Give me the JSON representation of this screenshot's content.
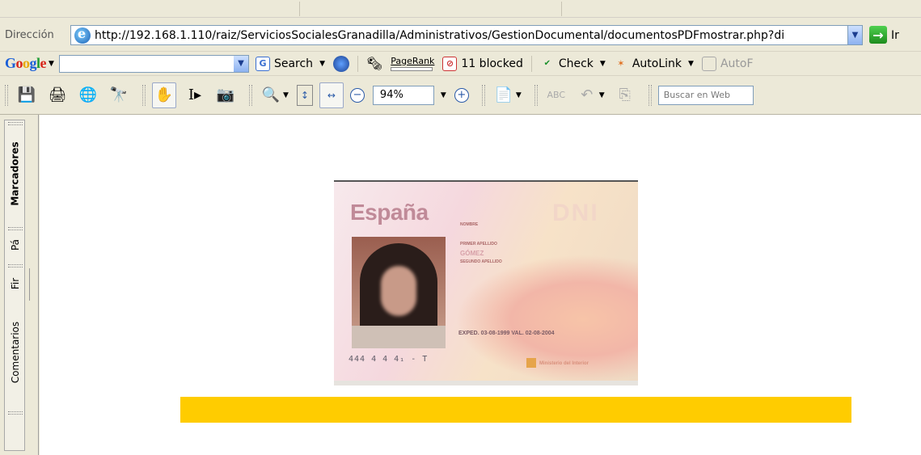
{
  "address_bar": {
    "label": "Dirección",
    "url": "http://192.168.1.110/raiz/ServiciosSocialesGranadilla/Administrativos/GestionDocumental/documentosPDFmostrar.php?di",
    "go_label": "Ir"
  },
  "google_bar": {
    "logo_parts": [
      "G",
      "o",
      "o",
      "g",
      "l",
      "e"
    ],
    "search_placeholder": "",
    "search_label": "Search",
    "pagerank_label": "PageRank",
    "blocked_label": "11 blocked",
    "check_label": "Check",
    "autolink_label": "AutoLink",
    "autofill_label": "AutoF"
  },
  "acrobat_toolbar": {
    "zoom_value": "94%",
    "search_web_placeholder": "Buscar en Web"
  },
  "side_tabs": {
    "bookmarks": "Marcadores",
    "pages": "Pá",
    "signatures": "Fir",
    "comments": "Comentarios"
  },
  "document": {
    "id_card": {
      "title": "España",
      "watermark": "DNI",
      "field_nombre": "NOMBRE",
      "field_primer_apellido": "PRIMER APELLIDO",
      "field_segundo_apellido": "SEGUNDO APELLIDO",
      "name_text": "GÓMEZ",
      "expedition": "EXPED. 03-08-1999   VAL. 02-08-2004",
      "number": "444 4 4 4₁ - T",
      "ministry": "Ministerio del Interior"
    },
    "highlight_color": "#ffcc00"
  }
}
